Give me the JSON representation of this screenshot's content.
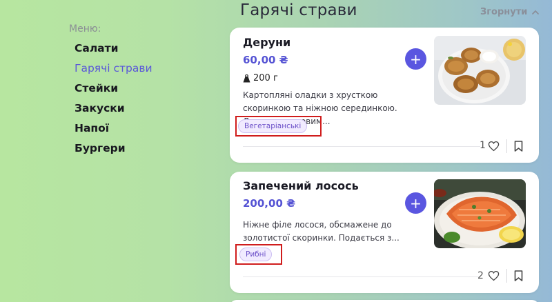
{
  "section": {
    "title": "Гарячі страви",
    "collapse_label": "Згорнути"
  },
  "menu": {
    "title": "Меню:",
    "items": [
      {
        "label": "Салати"
      },
      {
        "label": "Гарячі страви",
        "active": true
      },
      {
        "label": "Стейки"
      },
      {
        "label": "Закуски"
      },
      {
        "label": "Напої"
      },
      {
        "label": "Бургери"
      }
    ]
  },
  "dishes": [
    {
      "name": "Деруни",
      "price": "60,00 ₴",
      "weight": "200 г",
      "description": "Картопляні оладки з хрусткою скоринкою та ніжною серединкою. Деруни є чудовим...",
      "tag": "Вегетаріанські",
      "likes": "1",
      "add_icon": "plus-icon"
    },
    {
      "name": "Запечений лосось",
      "price": "200,00 ₴",
      "description": "Ніжне філе лосося, обсмажене до золотистої скоринки. Подається з...",
      "tag": "Рибні",
      "likes": "2",
      "add_icon": "plus-icon"
    }
  ],
  "colors": {
    "accent": "#5a56e0",
    "price": "#5553d4",
    "active_menu": "#5a58d8",
    "highlight_frame": "#d01c1c",
    "tag_bg": "#f1ebff"
  }
}
